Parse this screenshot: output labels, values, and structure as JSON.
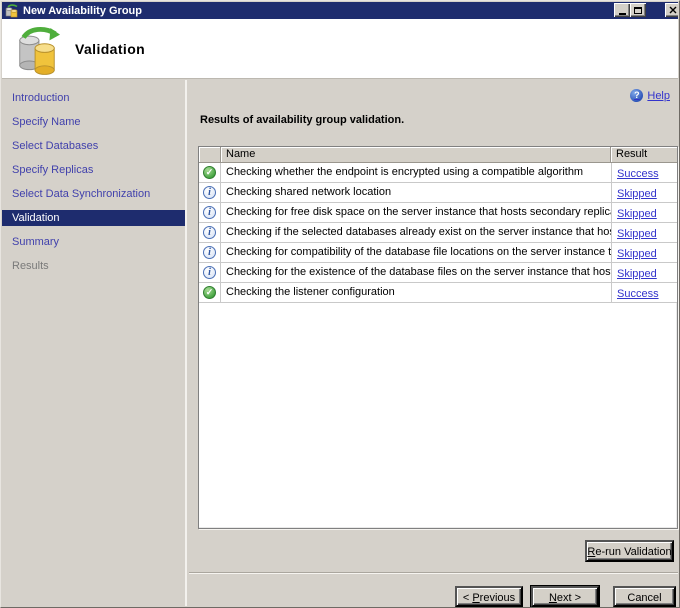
{
  "window": {
    "title": "New Availability Group"
  },
  "header": {
    "title": "Validation"
  },
  "help": {
    "label": "Help"
  },
  "sidebar": {
    "items": [
      {
        "label": "Introduction",
        "state": "link"
      },
      {
        "label": "Specify Name",
        "state": "link"
      },
      {
        "label": "Select Databases",
        "state": "link"
      },
      {
        "label": "Specify Replicas",
        "state": "link"
      },
      {
        "label": "Select Data Synchronization",
        "state": "link"
      },
      {
        "label": "Validation",
        "state": "selected"
      },
      {
        "label": "Summary",
        "state": "link"
      },
      {
        "label": "Results",
        "state": "disabled"
      }
    ]
  },
  "main": {
    "heading": "Results of availability group validation.",
    "table": {
      "columns": [
        "",
        "Name",
        "Result"
      ],
      "rows": [
        {
          "icon": "success",
          "name": "Checking whether the endpoint is encrypted using a compatible algorithm",
          "result": "Success"
        },
        {
          "icon": "info",
          "name": "Checking shared network location",
          "result": "Skipped"
        },
        {
          "icon": "info",
          "name": "Checking for free disk space on the server instance that hosts secondary replica ...",
          "result": "Skipped"
        },
        {
          "icon": "info",
          "name": "Checking if the selected databases already exist on the server instance that host...",
          "result": "Skipped"
        },
        {
          "icon": "info",
          "name": "Checking for compatibility of the database file locations on the server instance th...",
          "result": "Skipped"
        },
        {
          "icon": "info",
          "name": "Checking for the existence of the database files on the server instance that host...",
          "result": "Skipped"
        },
        {
          "icon": "success",
          "name": "Checking the listener configuration",
          "result": "Success"
        }
      ]
    },
    "buttons": {
      "rerun": {
        "pre": "",
        "key": "R",
        "post": "e-run Validation"
      },
      "previous": {
        "pre": "< ",
        "key": "P",
        "post": "revious"
      },
      "next": {
        "pre": "",
        "key": "N",
        "post": "ext >"
      },
      "cancel": {
        "label": "Cancel"
      }
    }
  },
  "icons": {
    "success": "✓",
    "info": "i",
    "help": "?"
  },
  "colors": {
    "titlebar": "#1E2C6E",
    "link": "#3333CC",
    "nav_link": "#4141AC",
    "nav_disabled": "#7A7A7A",
    "chrome": "#D4D0C8",
    "success_green": "#44A340",
    "info_blue": "#4A6FB5",
    "help_blue": "#2F55B8"
  }
}
